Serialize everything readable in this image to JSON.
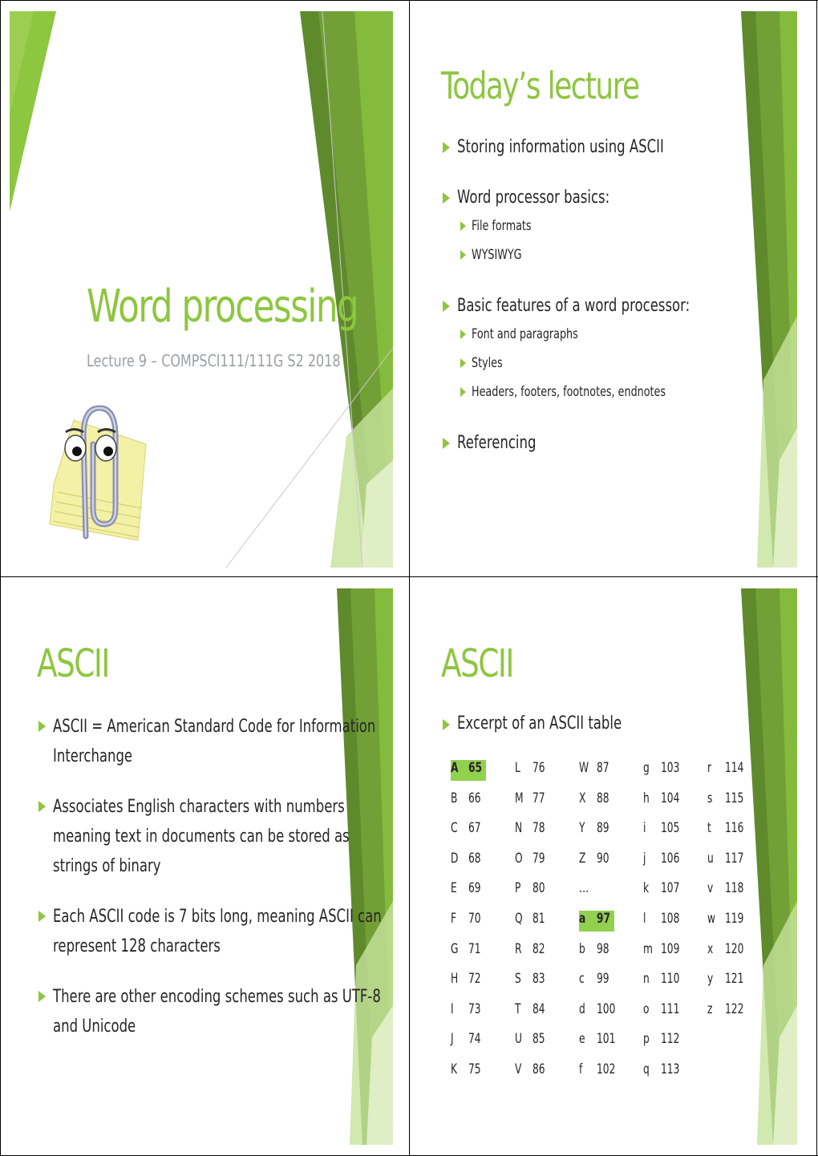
{
  "page": {
    "layout": "2x2 slide handout",
    "colors": {
      "accent_green": "#8dc63f",
      "dark_green": "#5f8a2c",
      "light_green": "#c6e29b",
      "highlight": "#92d050",
      "text": "#262626",
      "subtitle_gray": "#9aa0a6"
    }
  },
  "slides": [
    {
      "title": "Word processing",
      "subtitle": "Lecture 9 – COMPSCI111/111G S2 2018",
      "image": "clippy-paperclip-icon"
    },
    {
      "title": "Today’s lecture",
      "bullets": [
        {
          "text": "Storing information using ASCII",
          "sub": []
        },
        {
          "text": "Word processor basics:",
          "sub": [
            "File formats",
            "WYSIWYG"
          ]
        },
        {
          "text": "Basic features of a word processor:",
          "sub": [
            "Font and paragraphs",
            "Styles",
            "Headers, footers, footnotes, endnotes"
          ]
        },
        {
          "text": "Referencing",
          "sub": []
        }
      ]
    },
    {
      "title": "ASCII",
      "bullets": [
        {
          "lines": [
            "ASCII = American Standard Code for Information",
            "Interchange"
          ]
        },
        {
          "lines": [
            "Associates English characters with numbers",
            "meaning text in documents can be stored as",
            "strings of binary"
          ]
        },
        {
          "lines": [
            "Each ASCII code is 7 bits long, meaning ASCII can",
            "represent 128 characters"
          ]
        },
        {
          "lines": [
            "There are other encoding schemes such as UTF-8",
            "and Unicode"
          ]
        }
      ]
    },
    {
      "title": "ASCII",
      "bullet": "Excerpt of an ASCII table",
      "table": {
        "columns": [
          [
            [
              "A",
              "65",
              true
            ],
            [
              "B",
              "66"
            ],
            [
              "C",
              "67"
            ],
            [
              "D",
              "68"
            ],
            [
              "E",
              "69"
            ],
            [
              "F",
              "70"
            ],
            [
              "G",
              "71"
            ],
            [
              "H",
              "72"
            ],
            [
              "I",
              "73"
            ],
            [
              "J",
              "74"
            ],
            [
              "K",
              "75"
            ]
          ],
          [
            [
              "L",
              "76"
            ],
            [
              "M",
              "77"
            ],
            [
              "N",
              "78"
            ],
            [
              "O",
              "79"
            ],
            [
              "P",
              "80"
            ],
            [
              "Q",
              "81"
            ],
            [
              "R",
              "82"
            ],
            [
              "S",
              "83"
            ],
            [
              "T",
              "84"
            ],
            [
              "U",
              "85"
            ],
            [
              "V",
              "86"
            ]
          ],
          [
            [
              "W",
              "87"
            ],
            [
              "X",
              "88"
            ],
            [
              "Y",
              "89"
            ],
            [
              "Z",
              "90"
            ],
            [
              "…",
              ""
            ],
            [
              "a",
              "97",
              true
            ],
            [
              "b",
              "98"
            ],
            [
              "c",
              "99"
            ],
            [
              "d",
              "100"
            ],
            [
              "e",
              "101"
            ],
            [
              "f",
              "102"
            ]
          ],
          [
            [
              "g",
              "103"
            ],
            [
              "h",
              "104"
            ],
            [
              "i",
              "105"
            ],
            [
              "j",
              "106"
            ],
            [
              "k",
              "107"
            ],
            [
              "l",
              "108"
            ],
            [
              "m",
              "109"
            ],
            [
              "n",
              "110"
            ],
            [
              "o",
              "111"
            ],
            [
              "p",
              "112"
            ],
            [
              "q",
              "113"
            ]
          ],
          [
            [
              "r",
              "114"
            ],
            [
              "s",
              "115"
            ],
            [
              "t",
              "116"
            ],
            [
              "u",
              "117"
            ],
            [
              "v",
              "118"
            ],
            [
              "w",
              "119"
            ],
            [
              "x",
              "120"
            ],
            [
              "y",
              "121"
            ],
            [
              "z",
              "122"
            ]
          ]
        ]
      }
    }
  ]
}
